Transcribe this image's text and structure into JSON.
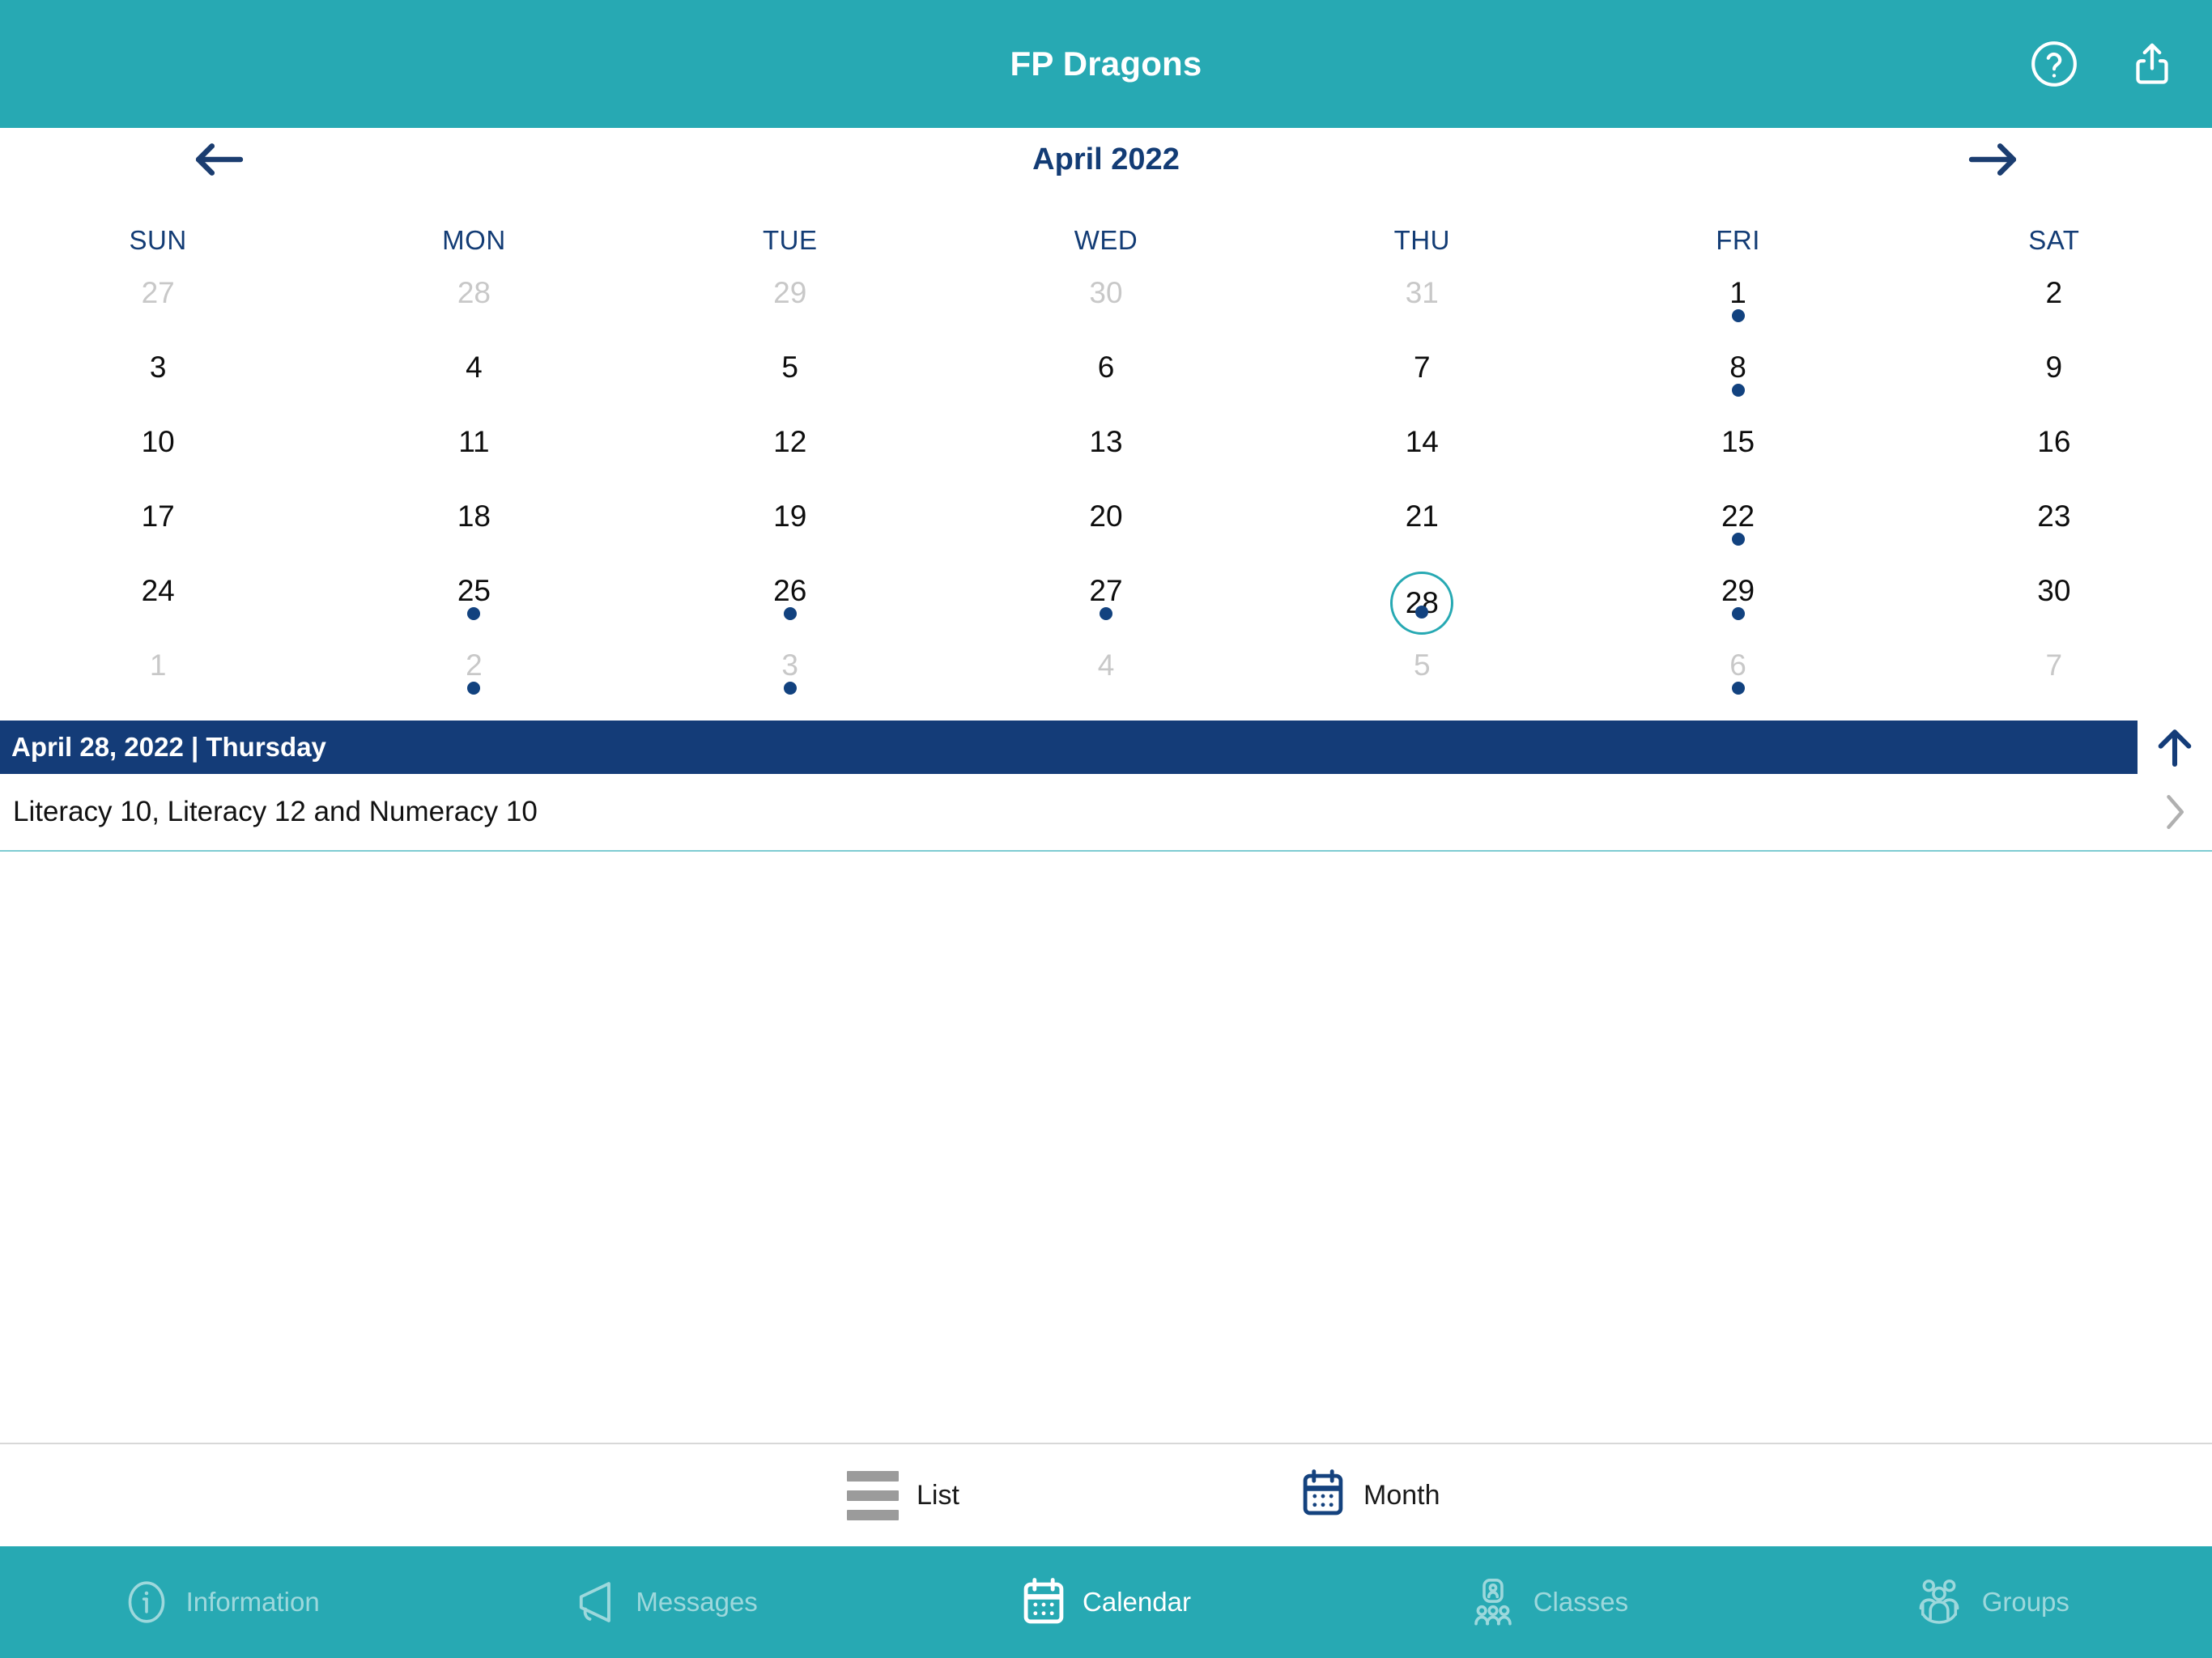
{
  "header": {
    "title": "FP Dragons",
    "help_icon": "help-circle-icon",
    "share_icon": "share-icon",
    "background_color": "#27A9B3"
  },
  "month_nav": {
    "prev_label": "Previous month",
    "next_label": "Next month",
    "title": "April 2022",
    "accent_color": "#133C75"
  },
  "calendar": {
    "weekday_headers": [
      "SUN",
      "MON",
      "TUE",
      "WED",
      "THU",
      "FRI",
      "SAT"
    ],
    "selected_day": 28,
    "dot_color": "#12427F",
    "selection_ring_color": "#27A9B3",
    "weeks": [
      [
        {
          "label": "27",
          "muted": true,
          "dot": false
        },
        {
          "label": "28",
          "muted": true,
          "dot": false
        },
        {
          "label": "29",
          "muted": true,
          "dot": false
        },
        {
          "label": "30",
          "muted": true,
          "dot": false
        },
        {
          "label": "31",
          "muted": true,
          "dot": false
        },
        {
          "label": "1",
          "muted": false,
          "dot": true
        },
        {
          "label": "2",
          "muted": false,
          "dot": false
        }
      ],
      [
        {
          "label": "3",
          "muted": false,
          "dot": false
        },
        {
          "label": "4",
          "muted": false,
          "dot": false
        },
        {
          "label": "5",
          "muted": false,
          "dot": false
        },
        {
          "label": "6",
          "muted": false,
          "dot": false
        },
        {
          "label": "7",
          "muted": false,
          "dot": false
        },
        {
          "label": "8",
          "muted": false,
          "dot": true
        },
        {
          "label": "9",
          "muted": false,
          "dot": false
        }
      ],
      [
        {
          "label": "10",
          "muted": false,
          "dot": false
        },
        {
          "label": "11",
          "muted": false,
          "dot": false
        },
        {
          "label": "12",
          "muted": false,
          "dot": false
        },
        {
          "label": "13",
          "muted": false,
          "dot": false
        },
        {
          "label": "14",
          "muted": false,
          "dot": false
        },
        {
          "label": "15",
          "muted": false,
          "dot": false
        },
        {
          "label": "16",
          "muted": false,
          "dot": false
        }
      ],
      [
        {
          "label": "17",
          "muted": false,
          "dot": false
        },
        {
          "label": "18",
          "muted": false,
          "dot": false
        },
        {
          "label": "19",
          "muted": false,
          "dot": false
        },
        {
          "label": "20",
          "muted": false,
          "dot": false
        },
        {
          "label": "21",
          "muted": false,
          "dot": false
        },
        {
          "label": "22",
          "muted": false,
          "dot": true
        },
        {
          "label": "23",
          "muted": false,
          "dot": false
        }
      ],
      [
        {
          "label": "24",
          "muted": false,
          "dot": false
        },
        {
          "label": "25",
          "muted": false,
          "dot": true
        },
        {
          "label": "26",
          "muted": false,
          "dot": true
        },
        {
          "label": "27",
          "muted": false,
          "dot": true
        },
        {
          "label": "28",
          "muted": false,
          "dot": true,
          "selected": true
        },
        {
          "label": "29",
          "muted": false,
          "dot": true
        },
        {
          "label": "30",
          "muted": false,
          "dot": false
        }
      ],
      [
        {
          "label": "1",
          "muted": true,
          "dot": false
        },
        {
          "label": "2",
          "muted": true,
          "dot": true
        },
        {
          "label": "3",
          "muted": true,
          "dot": true
        },
        {
          "label": "4",
          "muted": true,
          "dot": false
        },
        {
          "label": "5",
          "muted": true,
          "dot": false
        },
        {
          "label": "6",
          "muted": true,
          "dot": true
        },
        {
          "label": "7",
          "muted": true,
          "dot": false
        }
      ]
    ]
  },
  "day_header": {
    "text": "April 28, 2022 | Thursday",
    "collapse_icon": "arrow-up-icon",
    "background_color": "#143C78"
  },
  "events": [
    {
      "title": "Literacy 10, Literacy 12 and Numeracy 10",
      "chevron": "chevron-right-icon"
    }
  ],
  "view_switch": {
    "items": [
      {
        "label": "List",
        "icon": "list-icon",
        "active": false
      },
      {
        "label": "Month",
        "icon": "calendar-icon",
        "active": true
      }
    ]
  },
  "tabbar": {
    "background_color": "#27A9B3",
    "items": [
      {
        "label": "Information",
        "icon": "info-circle-icon",
        "active": false
      },
      {
        "label": "Messages",
        "icon": "megaphone-icon",
        "active": false
      },
      {
        "label": "Calendar",
        "icon": "calendar-icon",
        "active": true
      },
      {
        "label": "Classes",
        "icon": "classes-icon",
        "active": false
      },
      {
        "label": "Groups",
        "icon": "groups-icon",
        "active": false
      }
    ]
  }
}
